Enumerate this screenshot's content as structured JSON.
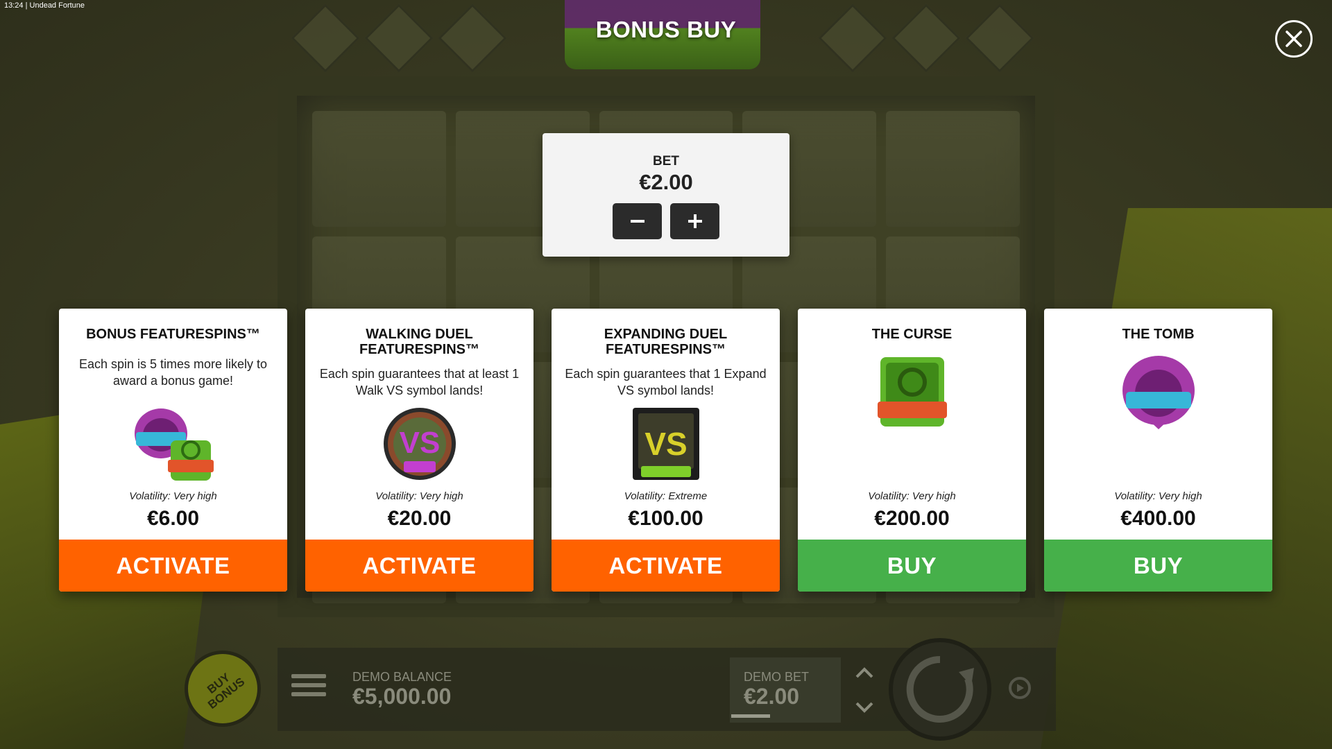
{
  "status_bar": {
    "time": "13:24",
    "app_title": "Undead Fortune"
  },
  "dialog": {
    "title": "BONUS BUY",
    "close_icon": "close-icon"
  },
  "bet_panel": {
    "label": "BET",
    "value": "€2.00",
    "decrease_icon": "minus-icon",
    "increase_icon": "plus-icon"
  },
  "cards": [
    {
      "title": "BONUS FEATURESPINS™",
      "description": "Each spin is 5 times more likely to award a bonus game!",
      "icon": "tomb-curse-symbols-icon",
      "volatility": "Volatility: Very high",
      "price": "€6.00",
      "button": "ACTIVATE",
      "button_color": "#ff6200"
    },
    {
      "title": "WALKING DUEL FEATURESPINS™",
      "description": "Each spin guarantees that at least 1 Walk VS symbol lands!",
      "icon": "walk-vs-symbol-icon",
      "volatility": "Volatility: Very high",
      "price": "€20.00",
      "button": "ACTIVATE",
      "button_color": "#ff6200"
    },
    {
      "title": "EXPANDING DUEL FEATURESPINS™",
      "description": "Each spin guarantees that 1 Expand VS symbol lands!",
      "icon": "expand-vs-symbol-icon",
      "volatility": "Volatility: Extreme",
      "price": "€100.00",
      "button": "ACTIVATE",
      "button_color": "#ff6200"
    },
    {
      "title": "THE CURSE",
      "description": "",
      "icon": "curse-symbol-icon",
      "volatility": "Volatility: Very high",
      "price": "€200.00",
      "button": "BUY",
      "button_color": "#46b04a"
    },
    {
      "title": "THE TOMB",
      "description": "",
      "icon": "tomb-symbol-icon",
      "volatility": "Volatility: Very high",
      "price": "€400.00",
      "button": "BUY",
      "button_color": "#46b04a"
    }
  ],
  "bottom_bar": {
    "buy_bonus": "BUY BONUS",
    "menu_icon": "hamburger-menu-icon",
    "balance_label": "DEMO BALANCE",
    "balance_value": "€5,000.00",
    "bet_label": "DEMO BET",
    "bet_value": "€2.00",
    "bet_arrows_icon": "chevron-up-down-icon",
    "spin_icon": "spin-arrow-icon",
    "autoplay_icon": "autoplay-icon"
  },
  "colors": {
    "activate": "#ff6200",
    "buy": "#46b04a",
    "panel": "#f3f3f3"
  }
}
